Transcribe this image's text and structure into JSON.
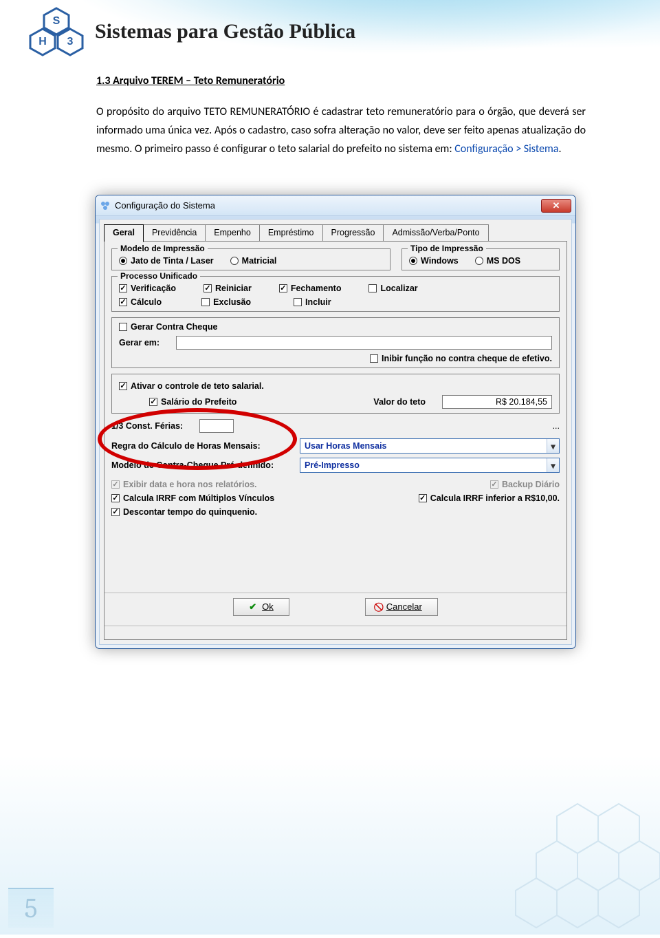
{
  "brand": {
    "tagline": "Sistemas para Gestão Pública"
  },
  "page": {
    "number": "5"
  },
  "doc": {
    "heading": "1.3 Arquivo TEREM – Teto Remuneratório",
    "paragraph_pre": "O propósito do arquivo TETO REMUNERATÓRIO é cadastrar teto remuneratório para o órgão, que deverá ser informado uma única vez. Após o cadastro, caso sofra alteração no valor, deve ser feito apenas atualização do mesmo. O primeiro passo é configurar o teto salarial do prefeito no sistema em: ",
    "paragraph_link": "Configuração > Sistema",
    "paragraph_post": "."
  },
  "win": {
    "title": "Configuração do Sistema",
    "close": "✕",
    "tabs": [
      "Geral",
      "Previdência",
      "Empenho",
      "Empréstimo",
      "Progressão",
      "Admissão/Verba/Ponto"
    ],
    "groups": {
      "modelo": {
        "legend": "Modelo de Impressão",
        "opts": [
          "Jato de Tinta / Laser",
          "Matricial"
        ]
      },
      "tipo": {
        "legend": "Tipo de Impressão",
        "opts": [
          "Windows",
          "MS DOS"
        ]
      },
      "processo": {
        "legend": "Processo Unificado",
        "opts": [
          "Verificação",
          "Reiniciar",
          "Fechamento",
          "Localizar",
          "Cálculo",
          "Exclusão",
          "Incluir"
        ]
      }
    },
    "contra": {
      "gerar_label": "Gerar Contra Cheque",
      "gerar_em_label": "Gerar em:",
      "inibir_label": "Inibir função no contra cheque de efetivo."
    },
    "teto": {
      "ativar_label": "Ativar o controle de teto salarial.",
      "salario_label": "Salário do Prefeito",
      "valor_label": "Valor do teto",
      "valor": "R$ 20.184,55"
    },
    "ferias_label": "1/3 Const. Férias:",
    "ferias_ell": "...",
    "regra_label": "Regra do Cálculo de Horas Mensais:",
    "regra_value": "Usar Horas Mensais",
    "modelo_cc_label": "Modelo de Contra-Cheque Pré-definido:",
    "modelo_cc_value": "Pré-Impresso",
    "misc": {
      "exibir": "Exibir data e hora nos relatórios.",
      "backup": "Backup Diário",
      "irrf_multi": "Calcula IRRF com Múltiplos Vínculos",
      "irrf_inf": "Calcula IRRF inferior a R$10,00.",
      "descontar": "Descontar tempo do quinquenio."
    },
    "buttons": {
      "ok": "Ok",
      "cancel": "Cancelar"
    }
  }
}
